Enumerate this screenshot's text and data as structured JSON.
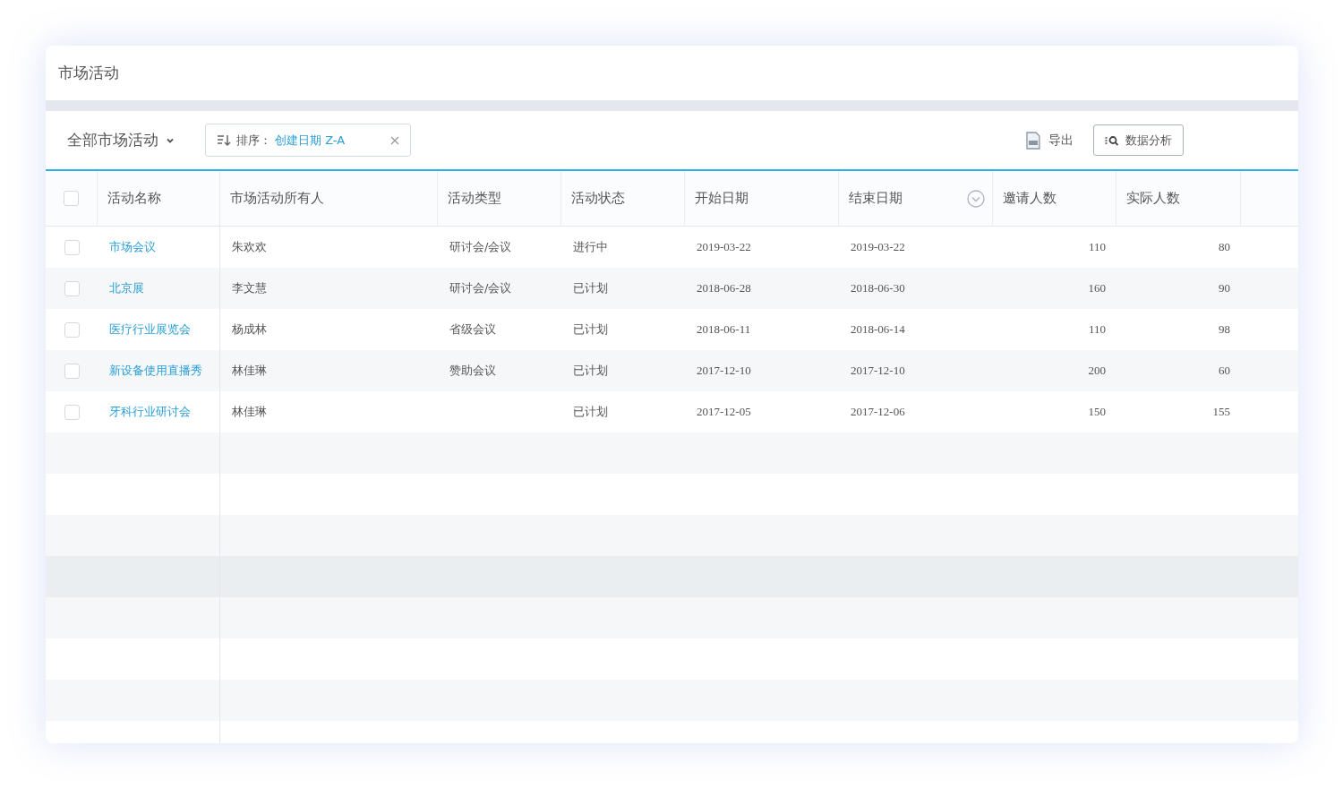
{
  "page": {
    "title": "市场活动"
  },
  "toolbar": {
    "view_selector": "全部市场活动",
    "sort_chip": {
      "label": "排序：",
      "value": "创建日期 Z-A"
    },
    "export_button": "导出",
    "analysis_button": "数据分析"
  },
  "table": {
    "select_all_checked": false,
    "columns": [
      {
        "label": "活动名称",
        "menu": false
      },
      {
        "label": "市场活动所有人",
        "menu": false
      },
      {
        "label": "活动类型",
        "menu": false
      },
      {
        "label": "活动状态",
        "menu": false
      },
      {
        "label": "开始日期",
        "menu": false
      },
      {
        "label": "结束日期",
        "menu": true
      },
      {
        "label": "邀请人数",
        "menu": false
      },
      {
        "label": "实际人数",
        "menu": false
      }
    ],
    "rows": [
      {
        "checked": false,
        "cells": [
          "市场会议",
          "朱欢欢",
          "研讨会/会议",
          "进行中",
          "2019-03-22",
          "2019-03-22",
          "110",
          "80"
        ]
      },
      {
        "checked": false,
        "cells": [
          "北京展",
          "李文慧",
          "研讨会/会议",
          "已计划",
          "2018-06-28",
          "2018-06-30",
          "160",
          "90"
        ]
      },
      {
        "checked": false,
        "cells": [
          "医疗行业展览会",
          "杨成林",
          "省级会议",
          "已计划",
          "2018-06-11",
          "2018-06-14",
          "110",
          "98"
        ]
      },
      {
        "checked": false,
        "cells": [
          "新设备使用直播秀",
          "林佳琳",
          "赞助会议",
          "已计划",
          "2017-12-10",
          "2017-12-10",
          "200",
          "60"
        ]
      },
      {
        "checked": false,
        "cells": [
          "牙科行业研讨会",
          "林佳琳",
          "",
          "已计划",
          "2017-12-05",
          "2017-12-06",
          "150",
          "155"
        ]
      }
    ]
  }
}
